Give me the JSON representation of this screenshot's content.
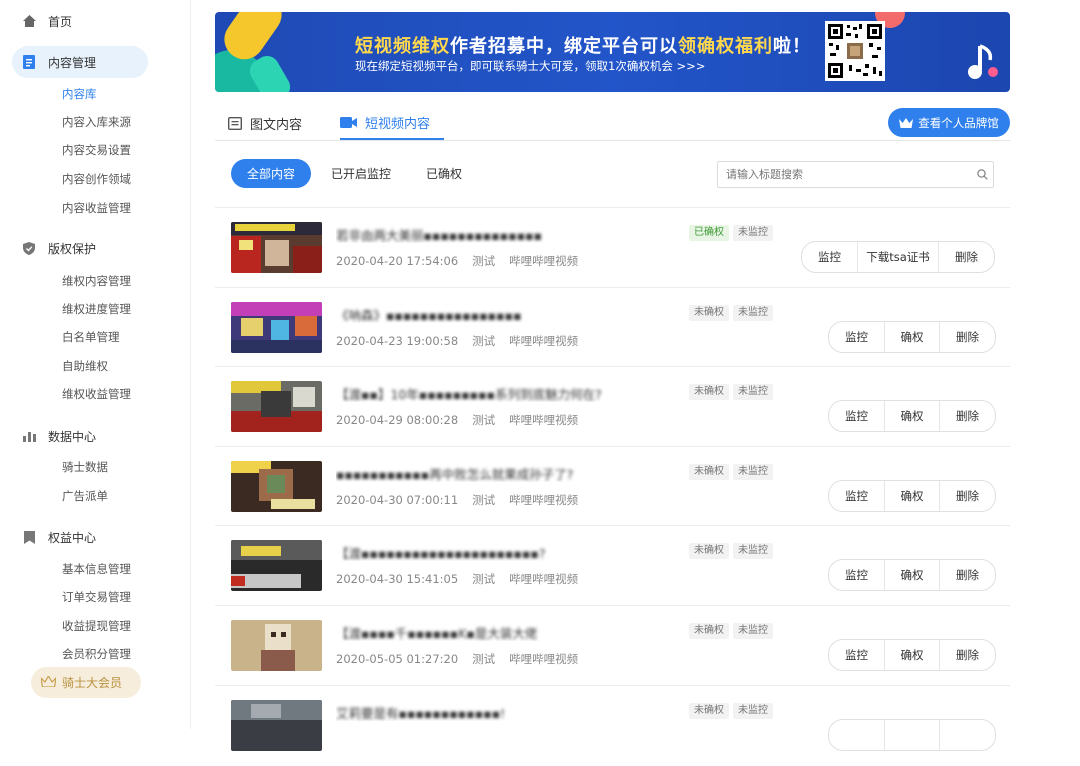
{
  "sidebar": {
    "home": "首页",
    "content_mgmt": "内容管理",
    "content_items": [
      "内容库",
      "内容入库来源",
      "内容交易设置",
      "内容创作领域",
      "内容收益管理"
    ],
    "copyright": "版权保护",
    "copyright_items": [
      "维权内容管理",
      "维权进度管理",
      "白名单管理",
      "自助维权",
      "维权收益管理"
    ],
    "data_center": "数据中心",
    "data_items": [
      "骑士数据",
      "广告派单"
    ],
    "rights_center": "权益中心",
    "rights_items": [
      "基本信息管理",
      "订单交易管理",
      "收益提现管理",
      "会员积分管理"
    ],
    "vip": "骑士大会员"
  },
  "banner": {
    "title_parts": [
      "短视频维权",
      "作者招募中，绑定平台可以",
      "领确权福利",
      "啦！"
    ],
    "subtitle": "现在绑定短视频平台，即可联系骑士大可爱，领取1次确权机会 >>>"
  },
  "tabs": {
    "article": "图文内容",
    "video": "短视频内容"
  },
  "brand_button": "查看个人品牌馆",
  "filters": {
    "all": "全部内容",
    "monitoring": "已开启监控",
    "confirmed": "已确权"
  },
  "search": {
    "placeholder": "请输入标题搜索"
  },
  "videos": [
    {
      "title": "若非由两大美丽▪▪▪▪▪▪▪▪▪▪▪▪▪▪",
      "date": "2020-04-20 17:54:06",
      "owner": "测试",
      "platform": "哔哩哔哩视频",
      "tag1": "已确权",
      "tag2": "未监控",
      "actions": [
        "监控",
        "下载tsa证书",
        "删除"
      ]
    },
    {
      "title": "《呐森》▪▪▪▪▪▪▪▪▪▪▪▪▪▪▪▪",
      "date": "2020-04-23 19:00:58",
      "owner": "测试",
      "platform": "哔哩哔哩视频",
      "tag1": "未确权",
      "tag2": "未监控",
      "actions": [
        "监控",
        "确权",
        "删除"
      ]
    },
    {
      "title": "【渡▪▪】10年▪▪▪▪▪▪▪▪▪系列到底魅力何在?",
      "date": "2020-04-29 08:00:28",
      "owner": "测试",
      "platform": "哔哩哔哩视频",
      "tag1": "未确权",
      "tag2": "未监控",
      "actions": [
        "监控",
        "确权",
        "删除"
      ]
    },
    {
      "title": "▪▪▪▪▪▪▪▪▪▪▪再中败怎么就果成孙子了?",
      "date": "2020-04-30 07:00:11",
      "owner": "测试",
      "platform": "哔哩哔哩视频",
      "tag1": "未确权",
      "tag2": "未监控",
      "actions": [
        "监控",
        "确权",
        "删除"
      ]
    },
    {
      "title": "【渡▪▪▪▪▪▪▪▪▪▪▪▪▪▪▪▪▪▪▪▪▪?",
      "date": "2020-04-30 15:41:05",
      "owner": "测试",
      "platform": "哔哩哔哩视频",
      "tag1": "未确权",
      "tag2": "未监控",
      "actions": [
        "监控",
        "确权",
        "删除"
      ]
    },
    {
      "title": "【渡▪▪▪▪千▪▪▪▪▪▪K▪是大装大佬",
      "date": "2020-05-05 01:27:20",
      "owner": "测试",
      "platform": "哔哩哔哩视频",
      "tag1": "未确权",
      "tag2": "未监控",
      "actions": [
        "监控",
        "确权",
        "删除"
      ]
    },
    {
      "title": "艾莉要是有▪▪▪▪▪▪▪▪▪▪▪▪!",
      "date": "",
      "owner": "",
      "platform": "",
      "tag1": "未确权",
      "tag2": "未监控",
      "actions": [
        "",
        "",
        ""
      ]
    }
  ],
  "colors": {
    "accent": "#2f80ed",
    "banner": "#2155c6",
    "confirmed": "#3e9b35",
    "vip": "#b8913e"
  }
}
